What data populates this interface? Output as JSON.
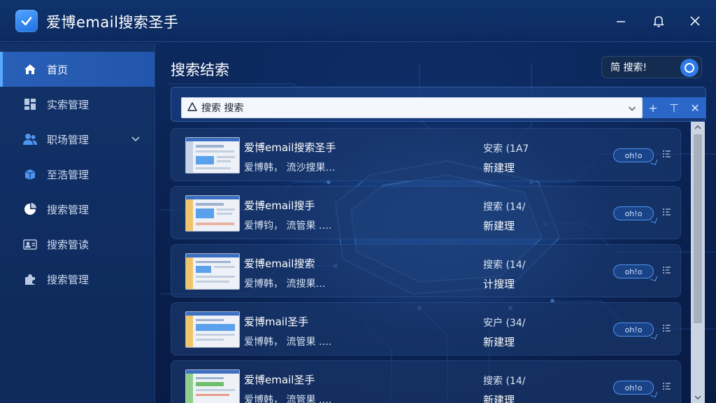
{
  "app": {
    "title": "爱博email搜索圣手"
  },
  "window": {
    "minimize": "—",
    "close": "✕"
  },
  "sidebar": {
    "items": [
      {
        "label": "首页",
        "icon": "home-icon",
        "active": true
      },
      {
        "label": "实索管理",
        "icon": "grid-icon"
      },
      {
        "label": "职场管理",
        "icon": "users-icon",
        "expandable": true
      },
      {
        "label": "至浩管理",
        "icon": "box-icon"
      },
      {
        "label": "搜索管理",
        "icon": "pie-chart-icon"
      },
      {
        "label": "搜索管读",
        "icon": "user-card-icon"
      },
      {
        "label": "搜索管理",
        "icon": "puzzle-icon"
      }
    ]
  },
  "main": {
    "title": "搜索结索",
    "toggle_label": "简 搜索!",
    "search": {
      "value": "搜索 搜索",
      "action_add": "+",
      "action_filter": "⊤",
      "action_clear": "✕"
    },
    "rows": [
      {
        "title": "爱博email搜索圣手",
        "subtitle": "爱博韩，  流沙搜果…",
        "col1": "安索 (1A7",
        "col2": "新建理",
        "badge": "oh!o"
      },
      {
        "title": "爱博email搜手",
        "subtitle": "爱博钧，  流管果 ….",
        "col1": "搜索 (14/",
        "col2": "新建理",
        "badge": "oh!o"
      },
      {
        "title": "爱博email搜索",
        "subtitle": "爱博韩，  流搜果…",
        "col1": "搜索 (14/",
        "col2": "计搜理",
        "badge": "oh!o"
      },
      {
        "title": "爱博mail圣手",
        "subtitle": "爱博韩，  流管果 ….",
        "col1": "安户 (34/",
        "col2": "新建理",
        "badge": "oh!o"
      },
      {
        "title": "爱博email圣手",
        "subtitle": "爱博韩，  流管果 ….",
        "col1": "搜索 (14/",
        "col2": "新建理",
        "badge": "oh!o"
      }
    ]
  },
  "colors": {
    "accent": "#2f7ae6",
    "sidebar_active": "#2a5fb8",
    "background": "#0a2350"
  }
}
